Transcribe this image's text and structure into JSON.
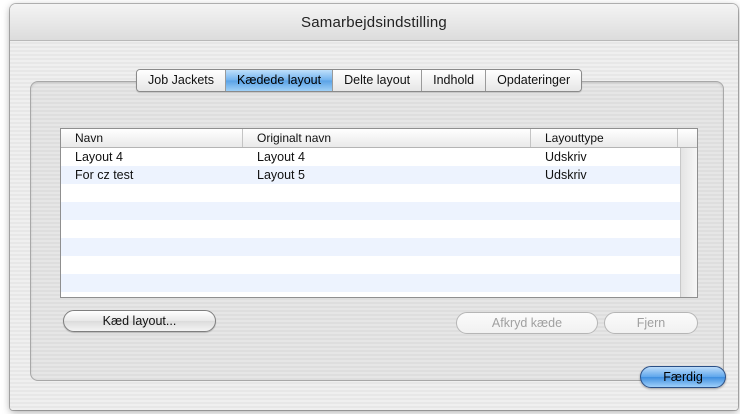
{
  "window": {
    "title": "Samarbejdsindstilling"
  },
  "tabs": [
    {
      "label": "Job Jackets",
      "active": false
    },
    {
      "label": "Kædede layout",
      "active": true
    },
    {
      "label": "Delte layout",
      "active": false
    },
    {
      "label": "Indhold",
      "active": false
    },
    {
      "label": "Opdateringer",
      "active": false
    }
  ],
  "table": {
    "columns": [
      "Navn",
      "Originalt navn",
      "Layouttype"
    ],
    "rows": [
      {
        "navn": "Layout 4",
        "originalt_navn": "Layout 4",
        "layouttype": "Udskriv"
      },
      {
        "navn": "For cz test",
        "originalt_navn": "Layout 5",
        "layouttype": "Udskriv"
      }
    ]
  },
  "buttons": {
    "link_layout": "Kæd layout...",
    "unlink": "Afkryd kæde",
    "remove": "Fjern",
    "done": "Færdig"
  },
  "colors": {
    "selected_tab": "#6fb1ee",
    "default_button": "#3f8fe0",
    "row_stripe": "#edf3fe"
  }
}
